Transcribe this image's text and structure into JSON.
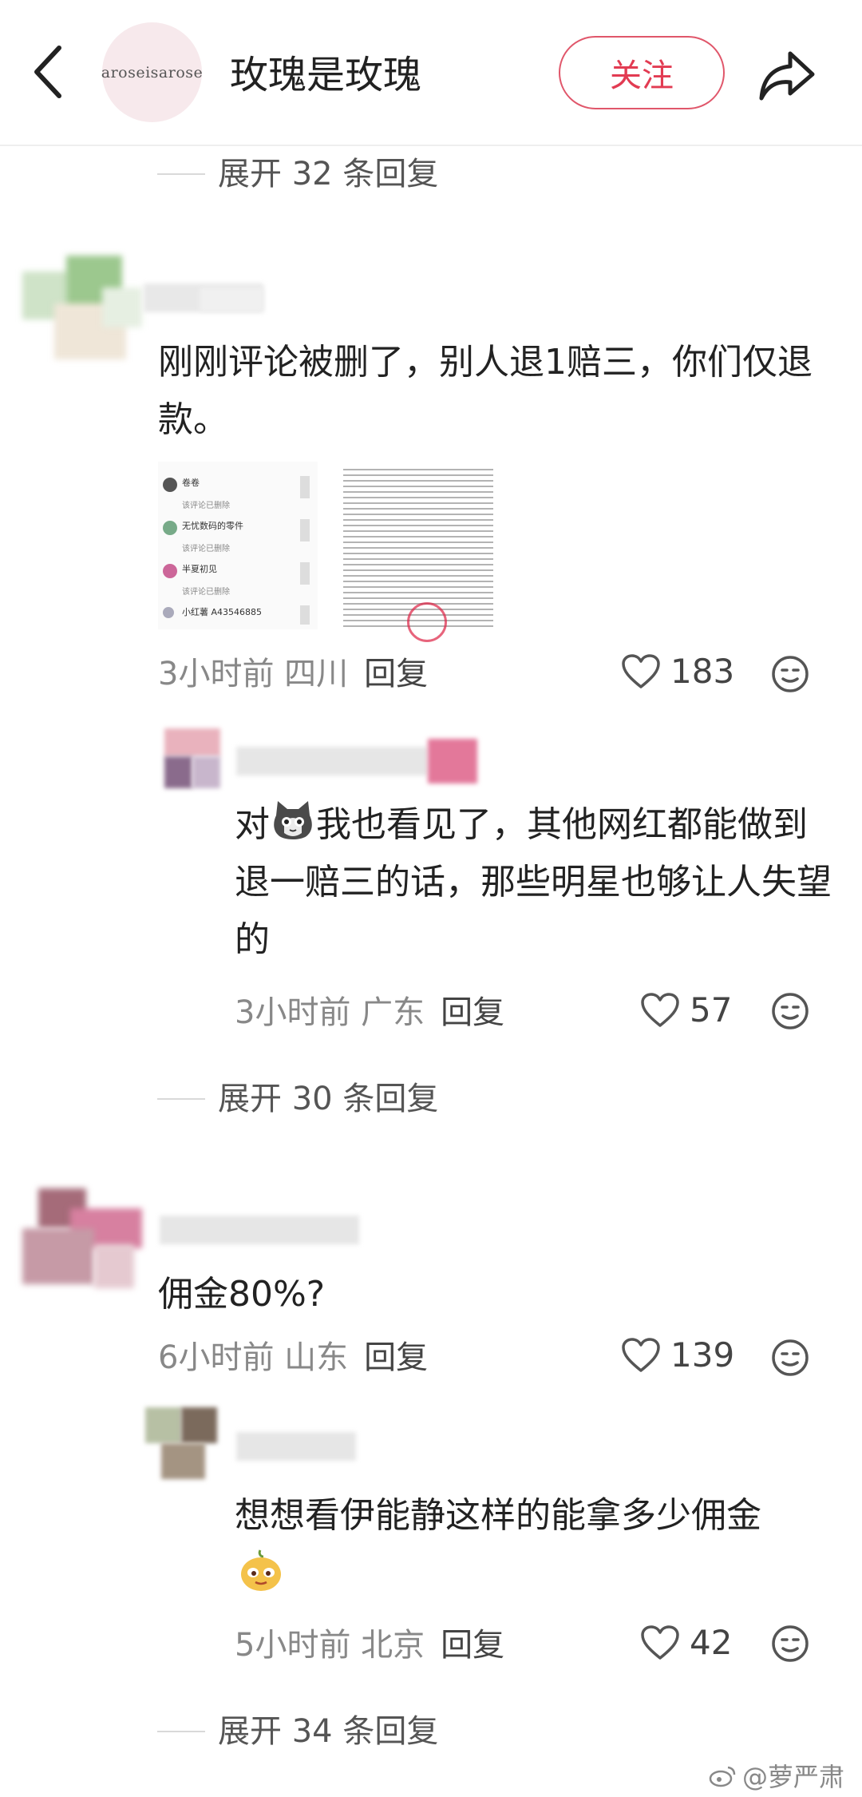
{
  "header": {
    "avatar_text": "aroseisarose",
    "title": "玫瑰是玫瑰",
    "follow_label": "关注"
  },
  "expanders": [
    {
      "label": "展开 32 条回复"
    },
    {
      "label": "展开 30 条回复"
    },
    {
      "label": "展开 34 条回复"
    }
  ],
  "comments": [
    {
      "text": "刚刚评论被删了，别人退1赔三，你们仅退款。",
      "time_location": "3小时前 四川",
      "reply_label": "回复",
      "likes": "183",
      "attachment": {
        "list_users": [
          "卷卷",
          "无忧数码的零件",
          "半夏初见",
          "小红薯 A43546885"
        ],
        "list_status": "该评论已删除"
      },
      "sub": {
        "text_before": "对",
        "text_after": "我也看见了，其他网红都能做到退一赔三的话，那些明星也够让人失望的",
        "time_location": "3小时前 广东",
        "reply_label": "回复",
        "likes": "57"
      }
    },
    {
      "text": "佣金80%?",
      "time_location": "6小时前 山东",
      "reply_label": "回复",
      "likes": "139",
      "sub": {
        "text": "想想看伊能静这样的能拿多少佣金",
        "time_location": "5小时前 北京",
        "reply_label": "回复",
        "likes": "42"
      }
    }
  ],
  "watermark": "@萝严肃",
  "colors": {
    "accent": "#e23b52",
    "muted": "#888888"
  }
}
